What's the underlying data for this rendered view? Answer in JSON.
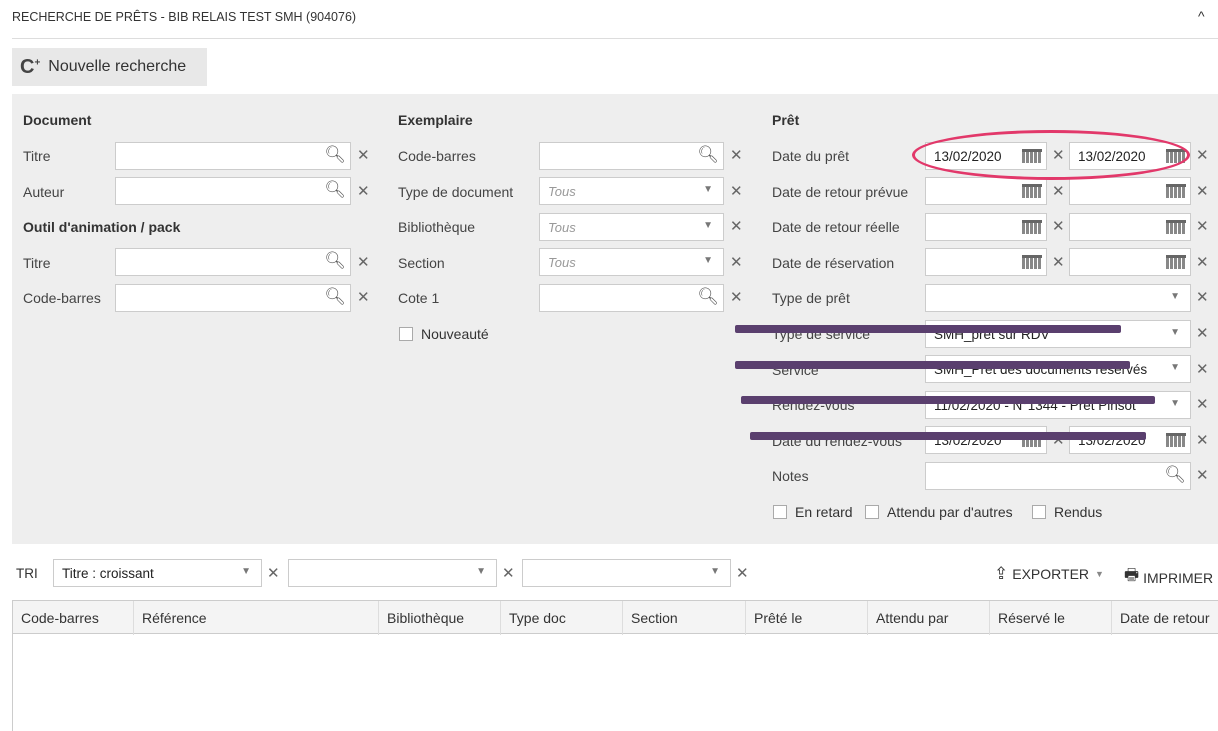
{
  "header": {
    "title": "RECHERCHE DE PRÊTS - BIB RELAIS TEST SMH (904076)",
    "collapse_icon": "^"
  },
  "new_search": {
    "label": "Nouvelle recherche",
    "icon": "search-plus-icon"
  },
  "document": {
    "title": "Document",
    "titre_label": "Titre",
    "auteur_label": "Auteur",
    "outil_title": "Outil d'animation / pack",
    "outil_titre_label": "Titre",
    "outil_codebarres_label": "Code-barres"
  },
  "exemplaire": {
    "title": "Exemplaire",
    "codebarres_label": "Code-barres",
    "typedoc_label": "Type de document",
    "typedoc_value": "Tous",
    "bibliotheque_label": "Bibliothèque",
    "bibliotheque_value": "Tous",
    "section_label": "Section",
    "section_value": "Tous",
    "cote_label": "Cote 1",
    "nouveaute_label": "Nouveauté"
  },
  "pret": {
    "title": "Prêt",
    "date_pret_label": "Date du prêt",
    "date_pret_from": "13/02/2020",
    "date_pret_to": "13/02/2020",
    "retour_prevue_label": "Date de retour prévue",
    "retour_reelle_label": "Date de retour réelle",
    "reservation_label": "Date de réservation",
    "type_pret_label": "Type de prêt",
    "type_service_label": "Type de service",
    "type_service_value": "SMH_prêt sur RDV",
    "service_label": "Service",
    "service_value": "SMH_Prêt des documents réservés",
    "rdv_label": "Rendez-vous",
    "rdv_value": "11/02/2020 - N°1344 - Prêt Pinsot",
    "date_rdv_label": "Date du rendez-vous",
    "date_rdv_from": "13/02/2020",
    "date_rdv_to": "13/02/2020",
    "notes_label": "Notes",
    "en_retard_label": "En retard",
    "attendu_label": "Attendu par d'autres",
    "rendus_label": "Rendus"
  },
  "sort": {
    "label": "TRI",
    "sort1_value": "Titre : croissant"
  },
  "toolbar": {
    "export_label": "EXPORTER",
    "print_label": "IMPRIMER"
  },
  "table": {
    "columns": [
      "Code-barres",
      "Référence",
      "Bibliothèque",
      "Type doc",
      "Section",
      "Prêté le",
      "Attendu par",
      "Réservé le",
      "Date de retour"
    ]
  },
  "colors": {
    "panel_bg": "#eeeeee",
    "annotation_ellipse": "#e2386a",
    "redaction_strike": "#5a3f6e"
  }
}
